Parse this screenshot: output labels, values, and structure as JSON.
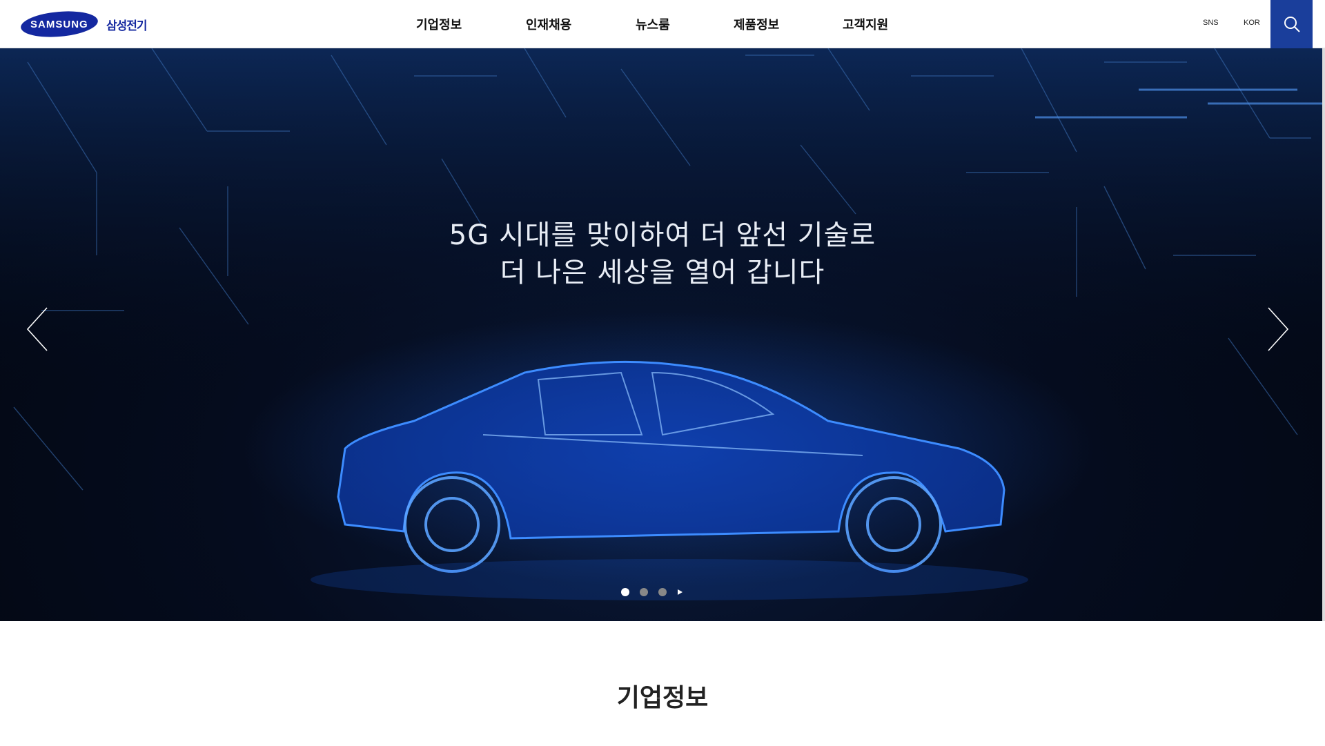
{
  "header": {
    "logo_text": "SAMSUNG",
    "logo_sub": "삼성전기",
    "nav": [
      "기업정보",
      "인재채용",
      "뉴스룸",
      "제품정보",
      "고객지원"
    ],
    "sns_label": "SNS",
    "lang_label": "KOR"
  },
  "hero": {
    "headline_line1": "5G 시대를 맞이하여 더 앞선 기술로",
    "headline_line2": "더 나은 세상을 열어 갑니다",
    "slide_count": 3,
    "active_slide": 1
  },
  "section": {
    "title": "기업정보"
  },
  "colors": {
    "brand_blue": "#1428a0",
    "search_bg": "#1a3e9b",
    "hero_glow": "#1e6bff"
  },
  "icons": [
    "search-icon",
    "arrow-left-icon",
    "arrow-right-icon",
    "play-icon"
  ]
}
